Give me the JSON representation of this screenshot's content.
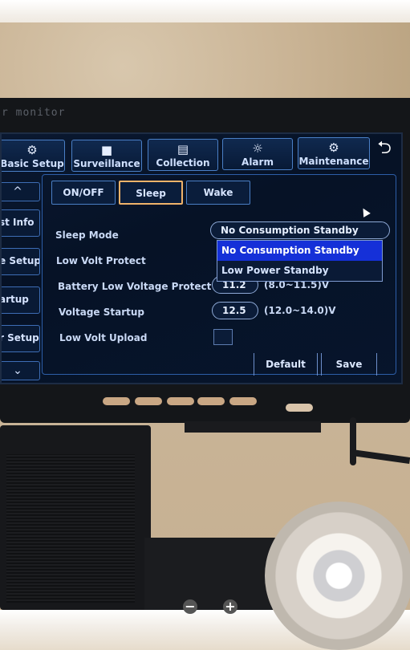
{
  "monitor": {
    "brand_text": "r monitor"
  },
  "tabs": [
    {
      "label": "Basic Setup",
      "icon": "gear-icon",
      "glyph": "⚙"
    },
    {
      "label": "Surveillance",
      "icon": "camera-icon",
      "glyph": "■"
    },
    {
      "label": "Collection",
      "icon": "document-icon",
      "glyph": "▤"
    },
    {
      "label": "Alarm",
      "icon": "alarm-icon",
      "glyph": "☼"
    },
    {
      "label": "Maintenance",
      "icon": "wrench-gear-icon",
      "glyph": "⚙"
    }
  ],
  "back_glyph": "⮌",
  "sidebar": {
    "up_glyph": "^",
    "items": [
      {
        "label": "st Info"
      },
      {
        "label": "e Setup"
      },
      {
        "label": "artup"
      },
      {
        "label": "r Setup"
      }
    ],
    "down_glyph": "⌄"
  },
  "subtabs": [
    {
      "label": "ON/OFF"
    },
    {
      "label": "Sleep"
    },
    {
      "label": "Wake"
    }
  ],
  "form": {
    "sleep_mode_label": "Sleep Mode",
    "sleep_mode_value": "No Consumption Standby",
    "low_volt_protect_label": "Low Volt Protect",
    "battery_label": "Battery Low Voltage Protect",
    "battery_value": "11.2",
    "battery_range": "(8.0~11.5)V",
    "voltage_startup_label": "Voltage Startup",
    "voltage_startup_value": "12.5",
    "voltage_startup_range": "(12.0~14.0)V",
    "low_volt_upload_label": "Low Volt Upload"
  },
  "dropdown": {
    "options": [
      {
        "label": "No Consumption Standby"
      },
      {
        "label": "Low Power Standby"
      }
    ],
    "selected": "No Consumption Standby"
  },
  "buttons": {
    "default_label": "Default",
    "save_label": "Save"
  },
  "hardware_buttons": [
    "",
    "",
    "",
    "",
    ""
  ],
  "zoom": {
    "minus": "−",
    "plus": "+"
  },
  "colors": {
    "accent": "#1530d8",
    "active_tab_border": "#f0b36a",
    "screen_bg": "#061226"
  }
}
